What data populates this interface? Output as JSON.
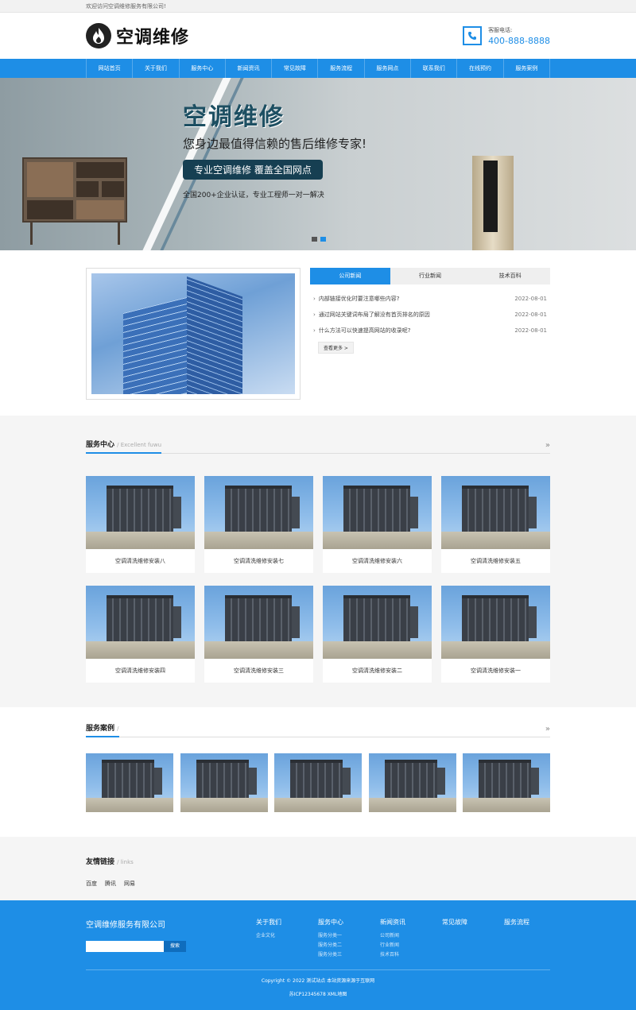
{
  "topbar": {
    "welcome": "欢迎访问空调维修服务有限公司!"
  },
  "header": {
    "logo_text": "空调维修",
    "hotline_label": "客服电话:",
    "hotline_number": "400-888-8888"
  },
  "nav": {
    "items": [
      "网站首页",
      "关于我们",
      "服务中心",
      "新闻资讯",
      "常见故障",
      "服务流程",
      "服务网点",
      "联系我们",
      "在线预约",
      "服务案例"
    ]
  },
  "banner": {
    "title": "空调维修",
    "subtitle": "您身边最值得信赖的售后维修专家!",
    "pill": "专业空调维修 覆盖全国网点",
    "note": "全国200+企业认证，专业工程师一对一解决"
  },
  "news": {
    "tabs": [
      "公司新闻",
      "行业新闻",
      "技术百科"
    ],
    "items": [
      {
        "title": "内部链接优化时要注意哪些内容?",
        "date": "2022-08-01"
      },
      {
        "title": "通过网站关键词布局了解没有首页排名的原因",
        "date": "2022-08-01"
      },
      {
        "title": "什么方法可以快速提高网站的收录呢?",
        "date": "2022-08-01"
      }
    ],
    "more": "查看更多 >"
  },
  "services": {
    "title": "服务中心",
    "subtitle": "/ Excellent fuwu",
    "more_icon": "»",
    "items": [
      "空调清洗维修安装八",
      "空调清洗维修安装七",
      "空调清洗维修安装六",
      "空调清洗维修安装五",
      "空调清洗维修安装四",
      "空调清洗维修安装三",
      "空调清洗维修安装二",
      "空调清洗维修安装一"
    ]
  },
  "cases": {
    "title": "服务案例",
    "subtitle": "/",
    "more_icon": "»"
  },
  "links": {
    "title": "友情链接",
    "subtitle": "/ links",
    "items": [
      "百度",
      "腾讯",
      "网易"
    ]
  },
  "footer": {
    "company": "空调维修服务有限公司",
    "search_button": "搜索",
    "columns": [
      {
        "title": "关于我们",
        "items": [
          "企业文化"
        ]
      },
      {
        "title": "服务中心",
        "items": [
          "服务分类一",
          "服务分类二",
          "服务分类三"
        ]
      },
      {
        "title": "新闻资讯",
        "items": [
          "公司新闻",
          "行业新闻",
          "技术百科"
        ]
      },
      {
        "title": "常见故障",
        "items": []
      },
      {
        "title": "服务流程",
        "items": []
      }
    ],
    "copyright": "Copyright © 2022 测试站点 本站资源来源于互联网",
    "icp": "苏ICP12345678 XML地图"
  },
  "colors": {
    "accent": "#1e8ee6",
    "dark_navy": "#163f52"
  }
}
